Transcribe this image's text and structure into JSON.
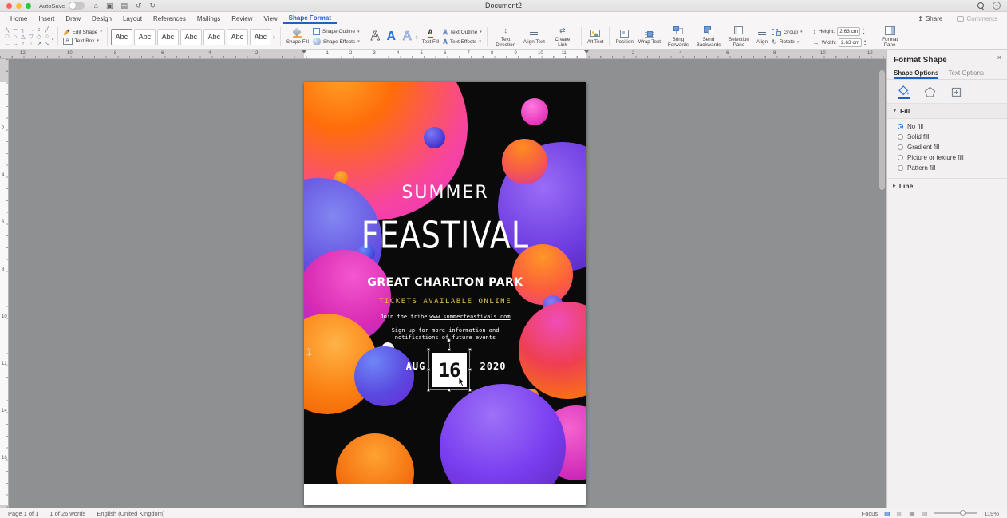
{
  "window": {
    "autosave_label": "AutoSave",
    "title": "Document2"
  },
  "icons": {
    "home": "⌂",
    "save": "▣",
    "print": "▤",
    "undo": "↺",
    "redo": "↻",
    "chevron_down": "▾",
    "more_arrow": "›",
    "gallery_up": "▴",
    "gallery_down": "▾",
    "share": "↥",
    "close": "×",
    "fill_collapse": "▼",
    "line_expand": "▶",
    "rotate": "↻",
    "v_arrows": "↕",
    "h_arrows": "↔",
    "swap": "⇄",
    "ellipsis": "⋯",
    "letter_a": "A",
    "view_print": "▤",
    "view_web": "▥",
    "view_outline": "▦",
    "view_draft": "▧"
  },
  "tabs": {
    "items": [
      "Home",
      "Insert",
      "Draw",
      "Design",
      "Layout",
      "References",
      "Mailings",
      "Review",
      "View",
      "Shape Format"
    ],
    "active": "Shape Format",
    "share": "Share",
    "comments": "Comments"
  },
  "ribbon": {
    "shape_gallery_rows": [
      "╲ ─ ┐ ↔ ↕ ╱",
      "□ ○ △ ▽ ◇ ☆",
      "← → ↑ ↓ ↗ ↘"
    ],
    "edit_shape": "Edit Shape",
    "text_box": "Text Box",
    "style_samples": [
      "Abc",
      "Abc",
      "Abc",
      "Abc",
      "Abc",
      "Abc",
      "Abc"
    ],
    "shape_fill": "Shape Fill",
    "shape_outline": "Shape Outline",
    "shape_effects": "Shape Effects",
    "wordart_samples": [
      "A",
      "A",
      "A"
    ],
    "text_fill": "Text Fill",
    "text_outline": "Text Outline",
    "text_effects": "Text Effects",
    "text_direction": "Text Direction",
    "align_text": "Align Text",
    "create_link": "Create Link",
    "alt_text": "Alt Text",
    "position": "Position",
    "wrap_text": "Wrap Text",
    "bring_forwards": "Bring Forwards",
    "send_backwards": "Send Backwards",
    "selection_pane": "Selection Pane",
    "align": "Align",
    "group": "Group",
    "rotate": "Rotate",
    "height_label": "Height:",
    "height_value": "2.63 cm",
    "width_label": "Width:",
    "width_value": "2.63 cm",
    "format_pane": "Format Pane"
  },
  "ruler": {
    "left_numbers": [
      "12",
      "10",
      "8",
      "6",
      "4",
      "2"
    ],
    "page_numbers": [
      "1",
      "2",
      "3",
      "4",
      "5",
      "6",
      "7",
      "8",
      "9",
      "10",
      "11"
    ],
    "right_numbers": [
      "2",
      "4",
      "6",
      "8",
      "10",
      "12"
    ],
    "v_numbers": [
      "2",
      "4",
      "6",
      "8",
      "10",
      "12",
      "14",
      "16"
    ]
  },
  "poster": {
    "title_top": "SUMMER",
    "title_main": "FEASTIVAL",
    "venue": "GREAT CHARLTON PARK",
    "tickets": "TICKETS AVAILABLE ONLINE",
    "join_prefix": "Join the tribe",
    "website": "www.summerfeastivals.com",
    "signup_line1": "Sign up for more information and",
    "signup_line2": "notifications of future events",
    "month": "AUG",
    "day": "16",
    "year": "2020"
  },
  "panel": {
    "title": "Format Shape",
    "tab_shape": "Shape Options",
    "tab_text": "Text Options",
    "fill_header": "Fill",
    "options": [
      "No fill",
      "Solid fill",
      "Gradient fill",
      "Picture or texture fill",
      "Pattern fill"
    ],
    "selected_option": "No fill",
    "line_header": "Line"
  },
  "status": {
    "page": "Page 1 of 1",
    "words": "1 of 26 words",
    "language": "English (United Kingdom)",
    "focus": "Focus",
    "zoom": "119%"
  },
  "colors": {
    "accent": "#2160c9",
    "selected_radio": "#1f6fe0",
    "ticket_text": "#e6c24a",
    "poster_background": "#0a0a0a"
  }
}
